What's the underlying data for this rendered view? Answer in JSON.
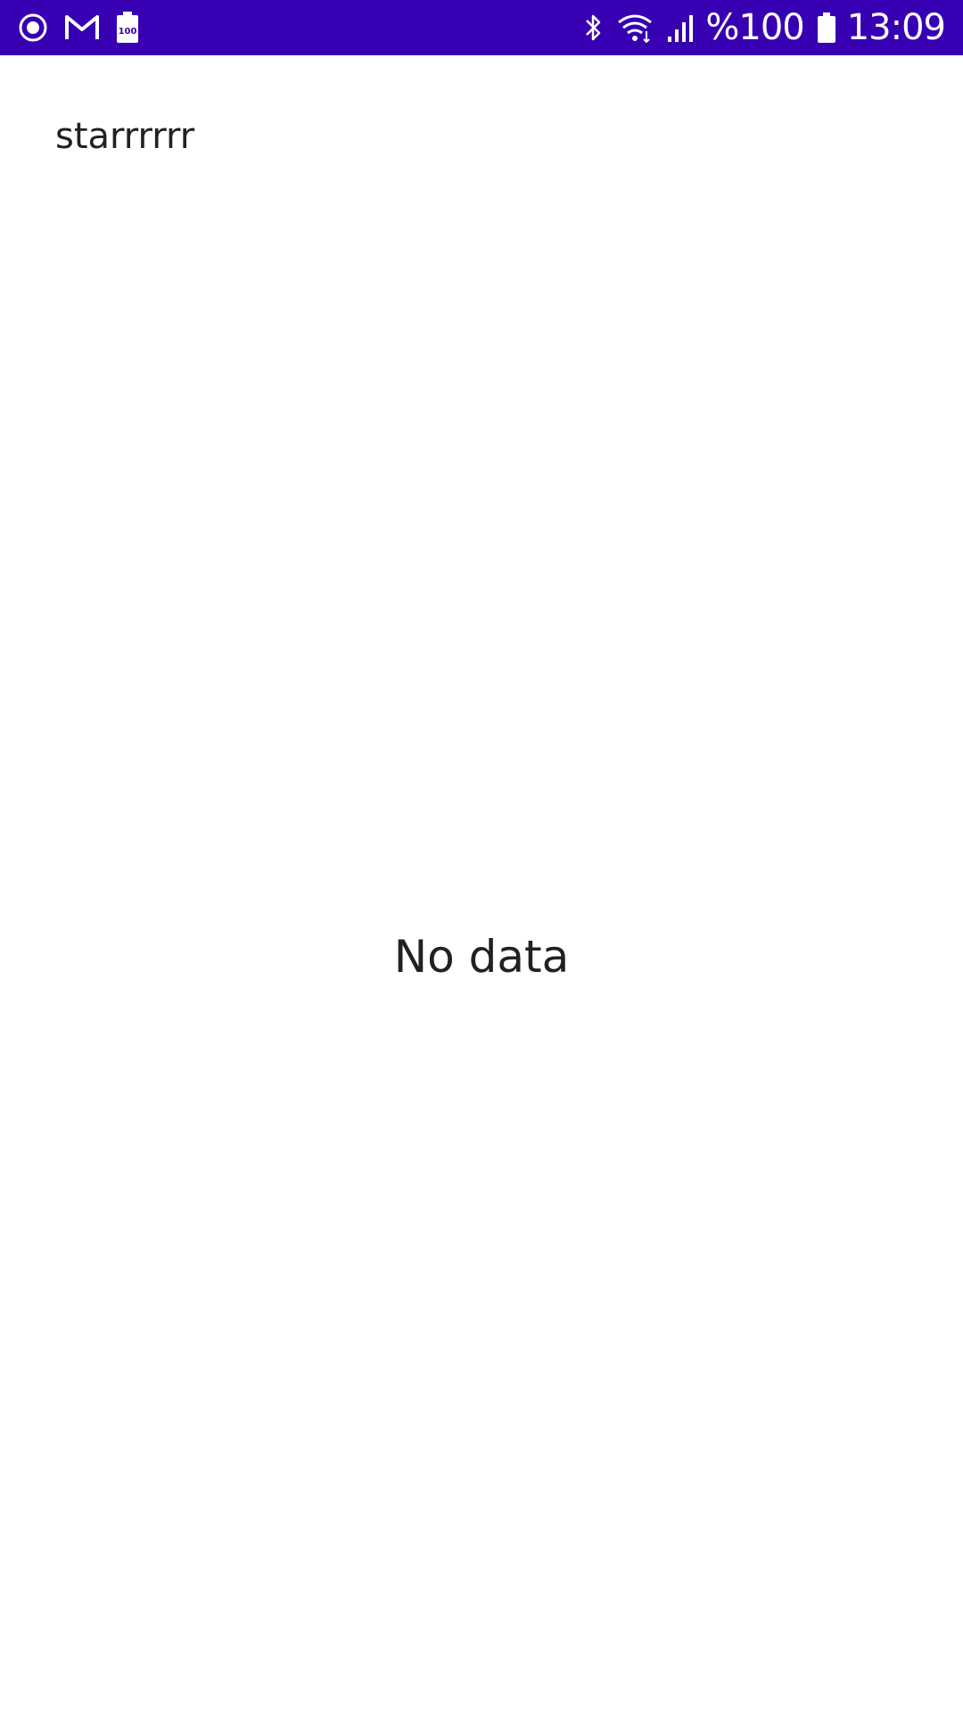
{
  "status_bar": {
    "background_color": "#3700b3",
    "left_icons": [
      "record-icon",
      "gmail-icon",
      "battery-100-notification-icon"
    ],
    "right_icons": [
      "bluetooth-icon",
      "wifi-icon",
      "signal-icon",
      "battery-icon"
    ],
    "battery_percent_text": "%100",
    "time": "13:09"
  },
  "page": {
    "title": "starrrrrr",
    "empty_message": "No data"
  }
}
